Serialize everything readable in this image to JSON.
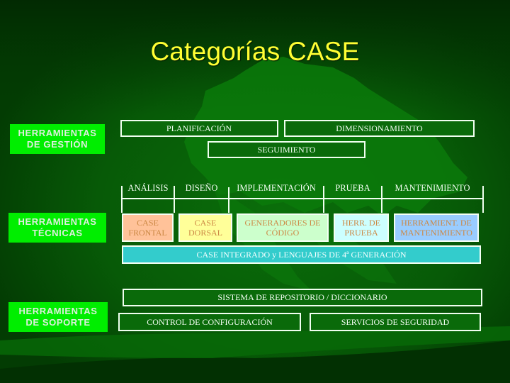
{
  "slide": {
    "title": "Categorías CASE"
  },
  "categories": {
    "management": {
      "line1": "HERRAMIENTAS",
      "line2": "DE GESTIÓN"
    },
    "technical": {
      "line1": "HERRAMIENTAS",
      "line2": "TÉCNICAS"
    },
    "support": {
      "line1": "HERRAMIENTAS",
      "line2": "DE SOPORTE"
    }
  },
  "management_tools": {
    "planning": "PLANIFICACIÓN",
    "sizing": "DIMENSIONAMIENTO",
    "tracking": "SEGUIMIENTO"
  },
  "phases": [
    "ANÁLISIS",
    "DISEÑO",
    "IMPLEMENTACIÓN",
    "PRUEBA",
    "MANTENIMIENTO"
  ],
  "technical_tools": [
    {
      "line1": "CASE",
      "line2": "FRONTAL",
      "color": "#ffc299"
    },
    {
      "line1": "CASE",
      "line2": "DORSAL",
      "color": "#ffff99"
    },
    {
      "line1": "GENERADORES DE",
      "line2": "CÓDIGO",
      "color": "#ccffcc"
    },
    {
      "line1": "HERR. DE",
      "line2": "PRUEBA",
      "color": "#ccffff"
    },
    {
      "line1": "HERRAMIENT. DE",
      "line2": "MANTENIMIENTO",
      "color": "#99ccff"
    }
  ],
  "integrated": "CASE INTEGRADO y LENGUAJES DE 4ª GENERACIÓN",
  "support_tools": {
    "repository": "SISTEMA DE REPOSITORIO / DICCIONARIO",
    "config": "CONTROL DE CONFIGURACIÓN",
    "security": "SERVICIOS DE SEGURIDAD"
  },
  "colors": {
    "title": "#ffff33",
    "category_bg": "#00ee00",
    "background": "#033d03",
    "integrated_bg": "#33cccc"
  }
}
